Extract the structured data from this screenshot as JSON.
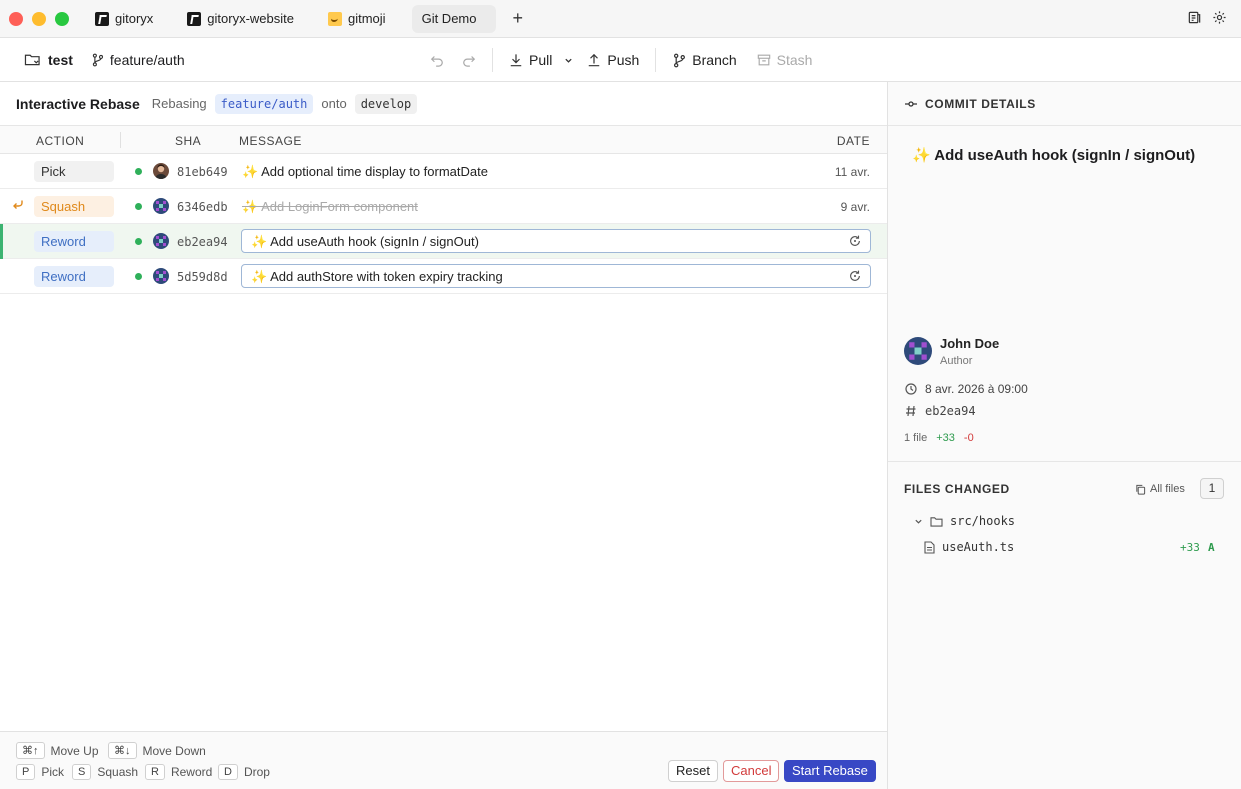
{
  "window": {
    "tabs": [
      {
        "label": "gitoryx",
        "icon": "gitoryx-icon"
      },
      {
        "label": "gitoryx-website",
        "icon": "gitoryx-icon"
      },
      {
        "label": "gitmoji",
        "icon": "gitmoji-icon"
      },
      {
        "label": "Git Demo",
        "active": true
      }
    ],
    "new_tab": "+"
  },
  "toolbar": {
    "repo": "test",
    "branch": "feature/auth",
    "pull": "Pull",
    "push": "Push",
    "branch_btn": "Branch",
    "stash": "Stash"
  },
  "rebase": {
    "title": "Interactive Rebase",
    "rebasing_label": "Rebasing",
    "source_branch": "feature/auth",
    "onto_label": "onto",
    "target_branch": "develop"
  },
  "columns": {
    "action": "ACTION",
    "sha": "SHA",
    "message": "MESSAGE",
    "date": "DATE"
  },
  "commits": [
    {
      "action": "Pick",
      "sha": "81eb649",
      "message": "✨ Add optional time display to formatDate",
      "date": "11 avr."
    },
    {
      "action": "Squash",
      "sha": "6346edb",
      "message": "✨ Add LoginForm component",
      "date": "9 avr."
    },
    {
      "action": "Reword",
      "sha": "eb2ea94",
      "message": "✨ Add useAuth hook (signIn / signOut)",
      "date": ""
    },
    {
      "action": "Reword",
      "sha": "5d59d8d",
      "message": "✨ Add authStore with token expiry tracking",
      "date": ""
    }
  ],
  "footer": {
    "move_up_key": "⌘↑",
    "move_up": "Move Up",
    "move_down_key": "⌘↓",
    "move_down": "Move Down",
    "pick_key": "P",
    "pick": "Pick",
    "squash_key": "S",
    "squash": "Squash",
    "reword_key": "R",
    "reword": "Reword",
    "drop_key": "D",
    "drop": "Drop",
    "reset": "Reset",
    "cancel": "Cancel",
    "start": "Start Rebase"
  },
  "details": {
    "header": "COMMIT DETAILS",
    "title": "✨ Add useAuth hook (signIn / signOut)",
    "author_name": "John Doe",
    "author_role": "Author",
    "date": "8 avr. 2026 à 09:00",
    "sha": "eb2ea94",
    "files_count": "1 file",
    "additions": "+33",
    "deletions": "-0"
  },
  "files_changed": {
    "header": "FILES CHANGED",
    "all_files": "All files",
    "count": "1",
    "dir": "src/hooks",
    "file": "useAuth.ts",
    "file_additions": "+33",
    "file_status": "A"
  },
  "colors": {
    "accent": "#3848c5",
    "squash": "#e0891a",
    "reword": "#3f6fc3",
    "added": "#2e9b4e",
    "removed": "#d23b3b"
  }
}
